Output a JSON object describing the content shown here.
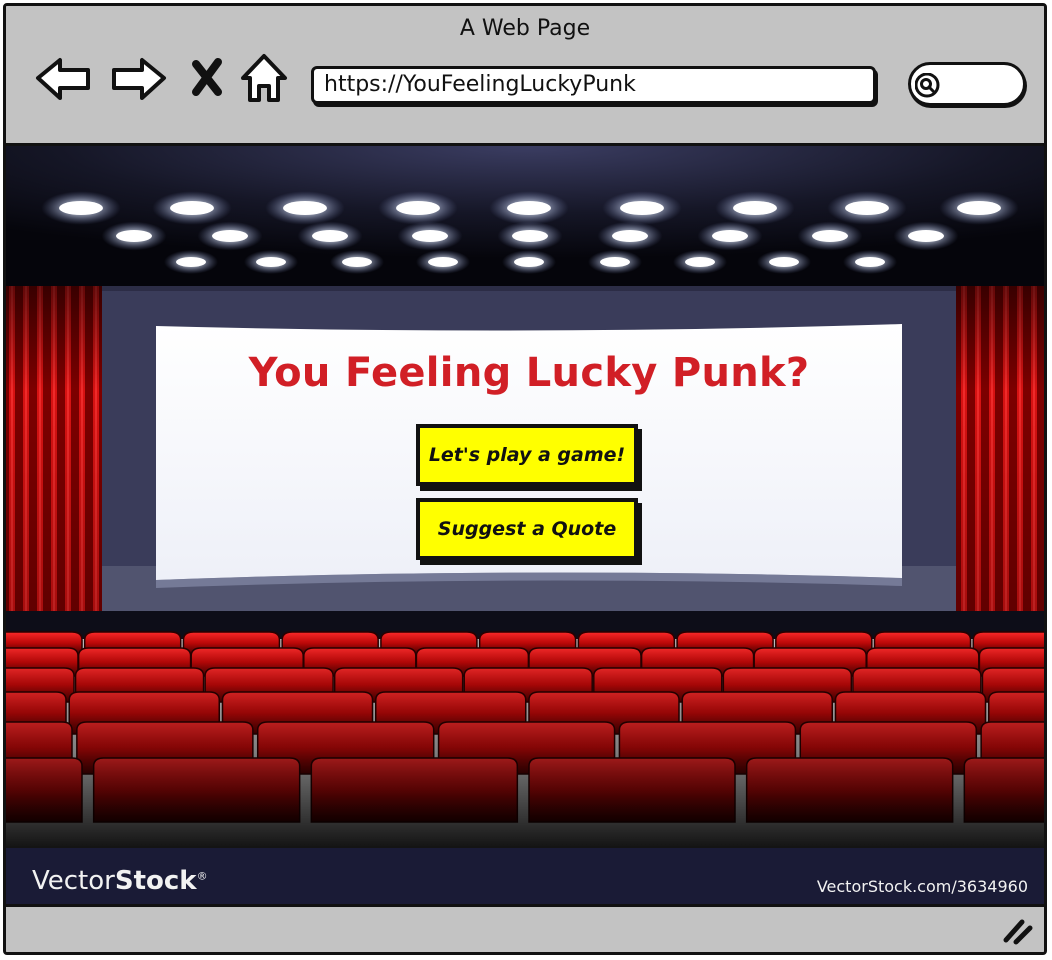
{
  "window": {
    "title": "A Web Page"
  },
  "nav": {
    "back_icon": "arrow-left-icon",
    "forward_icon": "arrow-right-icon",
    "stop_icon": "close-icon",
    "home_icon": "home-icon"
  },
  "address_bar": {
    "url": "https://YouFeelingLuckyPunk"
  },
  "search": {
    "icon": "search-icon"
  },
  "page": {
    "heading": "You Feeling Lucky Punk?",
    "buttons": [
      {
        "label": "Let's play a game!"
      },
      {
        "label": "Suggest a Quote"
      }
    ],
    "heading_color": "#d11f26",
    "button_color": "#ffff00"
  },
  "watermark": {
    "brand_light": "Vector",
    "brand_bold": "Stock",
    "registered": "®",
    "image_id": "VectorStock.com/3634960"
  },
  "status_bar": {
    "resize_icon": "resize-grip-icon"
  }
}
